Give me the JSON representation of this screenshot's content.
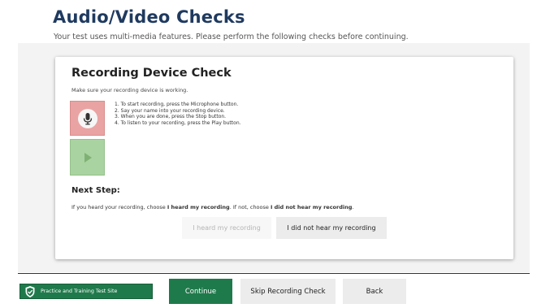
{
  "header": {
    "title": "Audio/Video Checks",
    "subtitle": "Your test uses multi-media features. Please perform the following checks before continuing."
  },
  "recording_check": {
    "title": "Recording Device Check",
    "subtitle": "Make sure your recording device is working.",
    "instructions": [
      "1. To start recording, press the Microphone button.",
      "2. Say your name into your recording device.",
      "3. When you are done, press the Stop button.",
      "4. To listen to your recording, press the Play button."
    ],
    "icons": {
      "record": "microphone-icon",
      "play": "play-icon"
    },
    "colors": {
      "record_bg": "#eaa3a3",
      "play_bg": "#a9d3a0"
    }
  },
  "next_step": {
    "heading": "Next Step:",
    "text_prefix": "If you heard your recording, choose ",
    "heard_choice": "I heard my recording",
    "text_middle": ". If not, choose ",
    "not_heard_choice": "I did not hear my recording",
    "text_suffix": ".",
    "heard_button": "I heard my recording",
    "not_heard_button": "I did not hear my recording"
  },
  "footer": {
    "site_label": "Practice and Training Test Site",
    "site_icon": "shield-logo-icon",
    "continue_label": "Continue",
    "skip_label": "Skip Recording Check",
    "back_label": "Back"
  },
  "colors": {
    "title": "#1f3a5f",
    "primary_green": "#1f7a4b",
    "button_gray": "#ececec"
  }
}
